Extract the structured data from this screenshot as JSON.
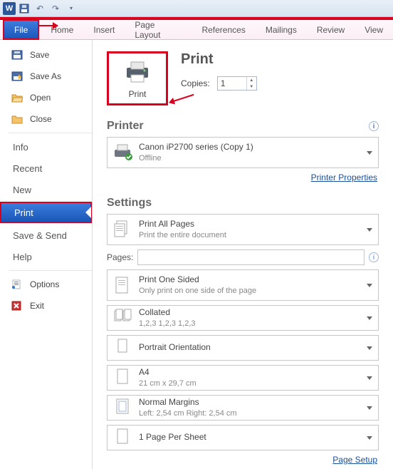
{
  "ribbon": {
    "file": "File",
    "tabs": [
      "Home",
      "Insert",
      "Page Layout",
      "References",
      "Mailings",
      "Review",
      "View"
    ]
  },
  "sidebar": {
    "save": "Save",
    "saveas": "Save As",
    "open": "Open",
    "close": "Close",
    "info": "Info",
    "recent": "Recent",
    "new": "New",
    "print": "Print",
    "savesend": "Save & Send",
    "help": "Help",
    "options": "Options",
    "exit": "Exit"
  },
  "print": {
    "title": "Print",
    "btn": "Print",
    "copies_label": "Copies:",
    "copies_value": "1"
  },
  "printer": {
    "heading": "Printer",
    "name": "Canon iP2700 series (Copy 1)",
    "status": "Offline",
    "properties": "Printer Properties"
  },
  "settings": {
    "heading": "Settings",
    "pages_label": "Pages:",
    "pages_value": "",
    "page_setup": "Page Setup",
    "opts": [
      {
        "title": "Print All Pages",
        "sub": "Print the entire document"
      },
      {
        "title": "Print One Sided",
        "sub": "Only print on one side of the page"
      },
      {
        "title": "Collated",
        "sub": "1,2,3   1,2,3   1,2,3"
      },
      {
        "title": "Portrait Orientation",
        "sub": ""
      },
      {
        "title": "A4",
        "sub": "21 cm x 29,7 cm"
      },
      {
        "title": "Normal Margins",
        "sub": "Left:  2,54 cm    Right:  2,54 cm"
      },
      {
        "title": "1 Page Per Sheet",
        "sub": ""
      }
    ]
  }
}
